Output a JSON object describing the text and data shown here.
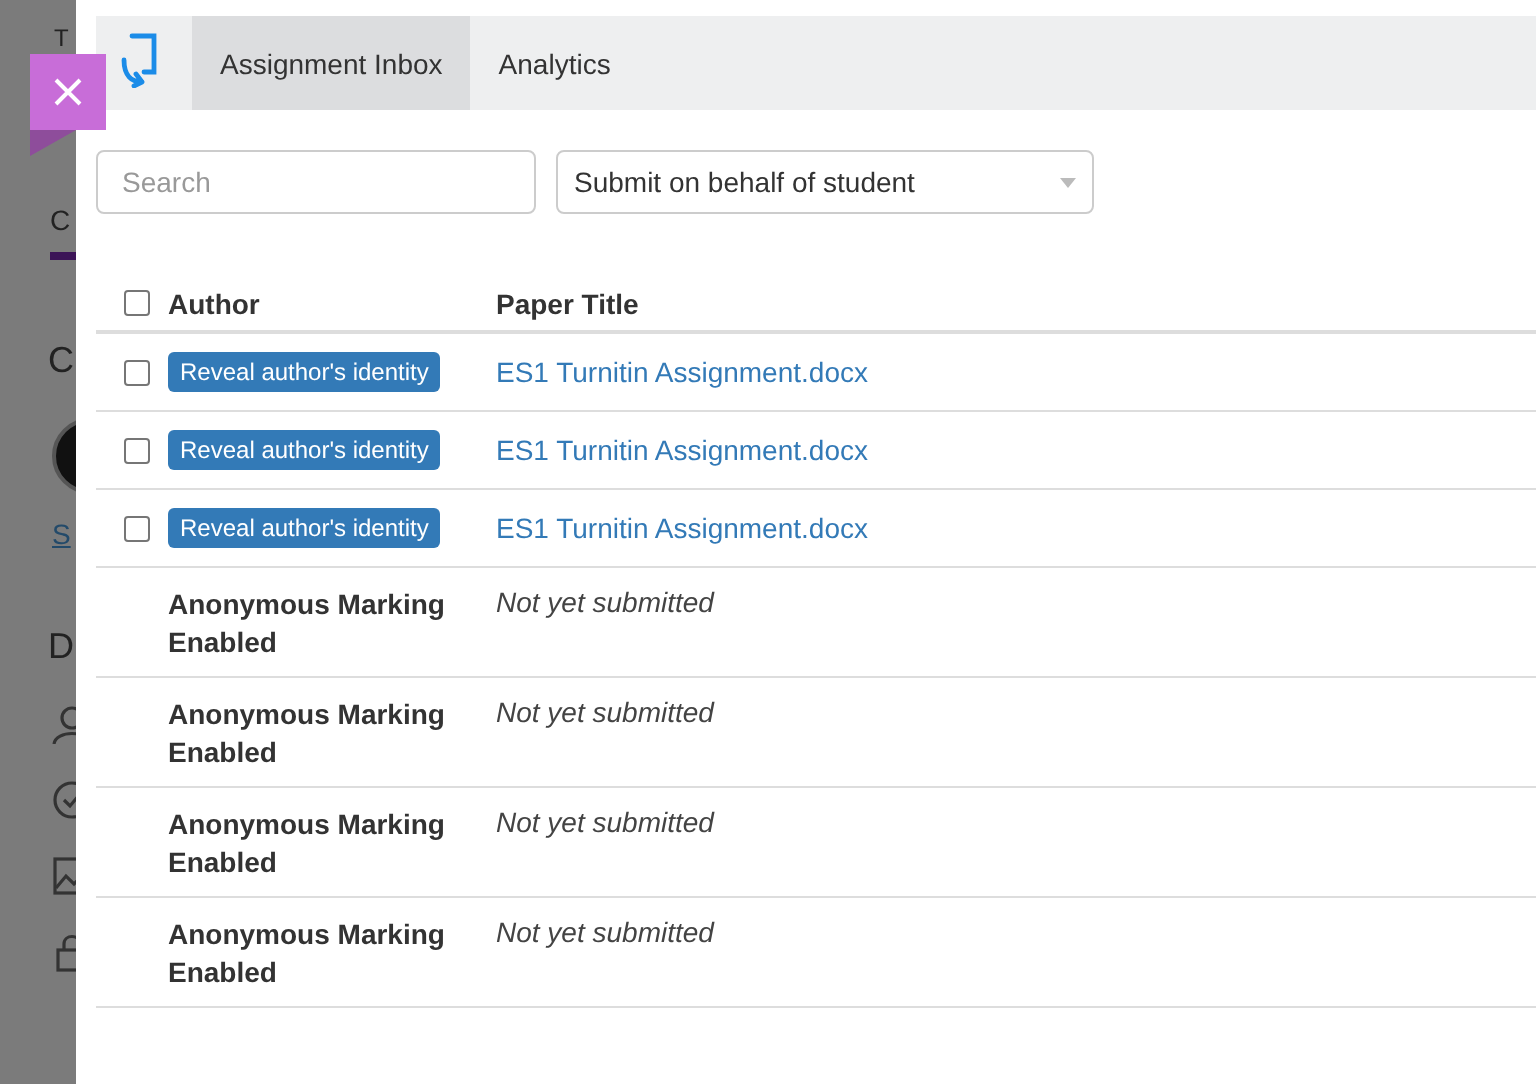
{
  "background_page": {
    "texts": [
      {
        "kind": "heading",
        "text": "T"
      },
      {
        "kind": "tab",
        "text": "C"
      },
      {
        "kind": "heading",
        "text": "C"
      },
      {
        "kind": "avatar"
      },
      {
        "kind": "link",
        "text": "S"
      },
      {
        "kind": "heading",
        "text": "D"
      },
      {
        "kind": "icon"
      },
      {
        "kind": "icon"
      },
      {
        "kind": "icon"
      },
      {
        "kind": "icon"
      }
    ]
  },
  "tabs": [
    {
      "label": "Assignment Inbox",
      "selected": true
    },
    {
      "label": "Analytics",
      "selected": false
    }
  ],
  "search": {
    "placeholder": "Search"
  },
  "submit_dropdown": {
    "value": "Submit on behalf of student"
  },
  "table": {
    "select_all": {
      "checked": false
    },
    "columns": [
      "Author",
      "Paper Title"
    ],
    "rows": [
      {
        "kind": "submitted",
        "checked": false,
        "author_button": "Reveal author's identity",
        "title": "ES1 Turnitin Assignment.docx"
      },
      {
        "kind": "submitted",
        "checked": false,
        "author_button": "Reveal author's identity",
        "title": "ES1 Turnitin Assignment.docx"
      },
      {
        "kind": "submitted",
        "checked": false,
        "author_button": "Reveal author's identity",
        "title": "ES1 Turnitin Assignment.docx"
      },
      {
        "kind": "pending",
        "author": "Anonymous Marking Enabled",
        "title": "Not yet submitted"
      },
      {
        "kind": "pending",
        "author": "Anonymous Marking Enabled",
        "title": "Not yet submitted"
      },
      {
        "kind": "pending",
        "author": "Anonymous Marking Enabled",
        "title": "Not yet submitted"
      },
      {
        "kind": "pending",
        "author": "Anonymous Marking Enabled",
        "title": "Not yet submitted"
      }
    ]
  }
}
